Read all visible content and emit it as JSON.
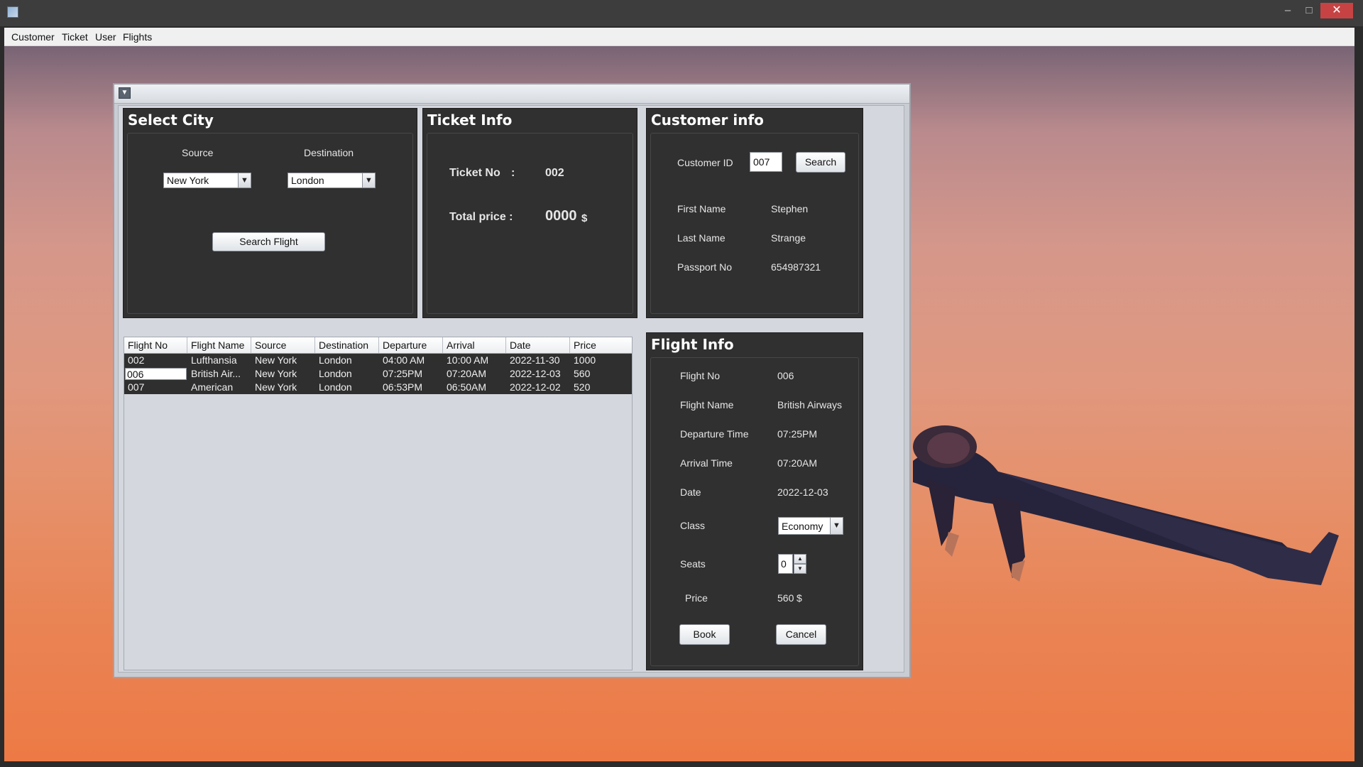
{
  "window": {
    "minimize_glyph": "–",
    "maximize_glyph": "□",
    "close_glyph": "✕"
  },
  "menubar": {
    "items": [
      "Customer",
      "Ticket",
      "User",
      "Flights"
    ]
  },
  "select_city": {
    "title": "Select City",
    "source_label": "Source",
    "destination_label": "Destination",
    "source_value": "New York",
    "destination_value": "London",
    "search_button": "Search Flight"
  },
  "ticket_info": {
    "title": "Ticket Info",
    "ticket_no_label": "Ticket No",
    "ticket_no_sep": ":",
    "ticket_no_value": "002",
    "total_price_label": "Total price :",
    "total_price_value": "0000",
    "currency": "$"
  },
  "customer_info": {
    "title": "Customer info",
    "customer_id_label": "Customer ID",
    "customer_id_value": "007",
    "search_button": "Search",
    "first_name_label": "First Name",
    "first_name_value": "Stephen",
    "last_name_label": "Last Name",
    "last_name_value": "Strange",
    "passport_label": "Passport No",
    "passport_value": "654987321"
  },
  "flights_table": {
    "columns": [
      "Flight No",
      "Flight Name",
      "Source",
      "Destination",
      "Departure",
      "Arrival",
      "Date",
      "Price"
    ],
    "rows": [
      [
        "002",
        "Lufthansia",
        "New York",
        "London",
        "04:00 AM",
        "10:00 AM",
        "2022-11-30",
        "1000"
      ],
      [
        "006",
        "British Air...",
        "New York",
        "London",
        "07:25PM",
        "07:20AM",
        "2022-12-03",
        "560"
      ],
      [
        "007",
        "American",
        "New York",
        "London",
        "06:53PM",
        "06:50AM",
        "2022-12-02",
        "520"
      ]
    ]
  },
  "flight_info": {
    "title": "Flight Info",
    "flight_no_label": "Flight No",
    "flight_no_value": "006",
    "flight_name_label": "Flight Name",
    "flight_name_value": "British Airways",
    "departure_label": "Departure Time",
    "departure_value": "07:25PM",
    "arrival_label": "Arrival Time",
    "arrival_value": "07:20AM",
    "date_label": "Date",
    "date_value": "2022-12-03",
    "class_label": "Class",
    "class_value": "Economy",
    "seats_label": "Seats",
    "seats_value": "0",
    "price_label": "Price",
    "price_value": "560",
    "currency": "$",
    "book_button": "Book",
    "cancel_button": "Cancel"
  },
  "colors": {
    "panel_bg": "#303030",
    "close_button": "#c74343",
    "window_body": "#d4d7de"
  }
}
